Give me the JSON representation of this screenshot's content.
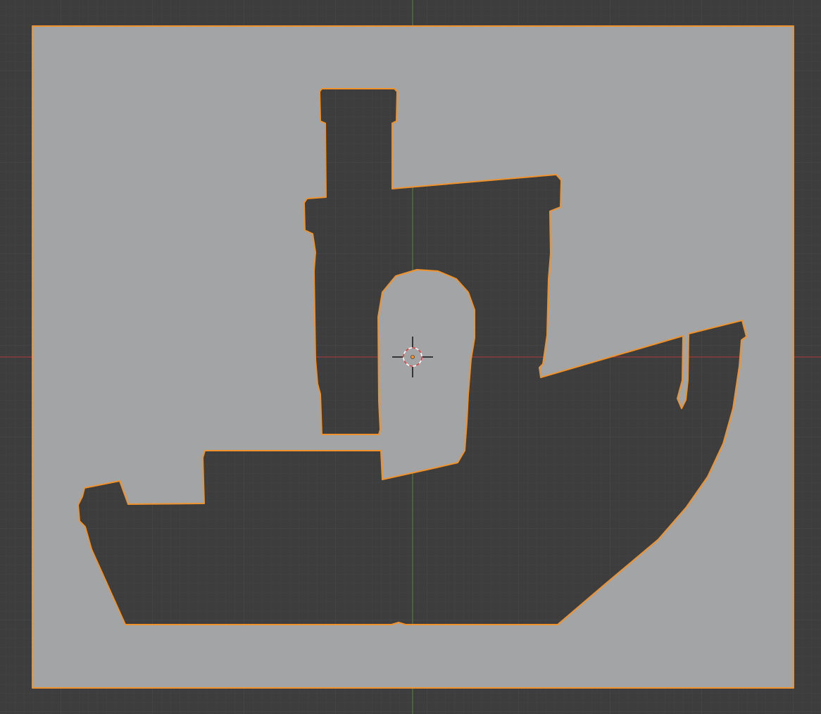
{
  "viewport": {
    "view": "top-orthographic",
    "background_color": "#3d3d3d",
    "grid_minor_color": "#434343",
    "grid_major_color": "#4a4a4a",
    "x_axis_color": "#b33a3a",
    "y_axis_color": "#5c8a2a"
  },
  "object": {
    "name_icon": "plane-object",
    "selected": true,
    "fill_color": "#a3a4a5",
    "outline_color": "#f0922c",
    "cutout_shape": "3D Benchy boat silhouette",
    "cutout_color": "#3d3d3d"
  },
  "cursor": {
    "icon": "3d-cursor-icon",
    "ring_colors": [
      "#ffffff",
      "#d03a3a"
    ],
    "origin_color": "#f0922c"
  }
}
